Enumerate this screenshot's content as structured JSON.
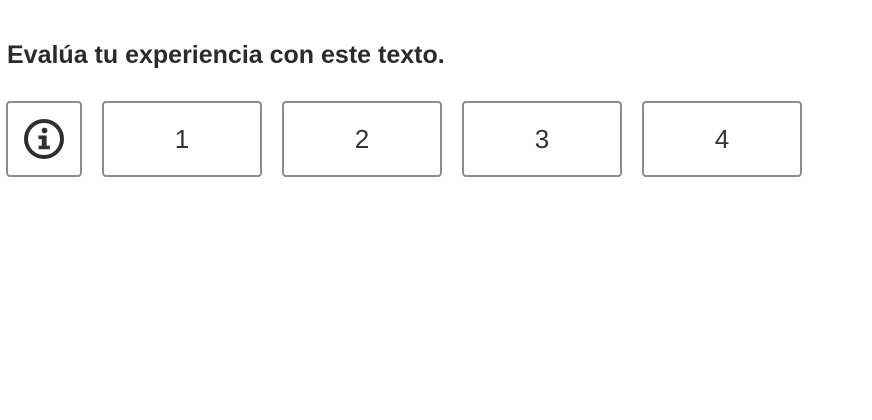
{
  "prompt": {
    "title": "Evalúa tu experiencia con este texto."
  },
  "info_button": {
    "icon": "info-circle-icon"
  },
  "rating": {
    "options": [
      "1",
      "2",
      "3",
      "4"
    ]
  },
  "colors": {
    "text": "#2b2b2b",
    "border": "#8d8d8d",
    "background": "#ffffff"
  }
}
